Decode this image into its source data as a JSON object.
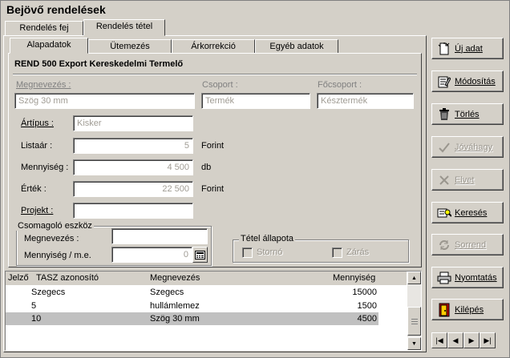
{
  "window": {
    "title": "Bejövő rendelések"
  },
  "outer_tabs": [
    {
      "label": "Rendelés fej"
    },
    {
      "label": "Rendelés tétel"
    }
  ],
  "inner_tabs": [
    {
      "label": "Alapadatok"
    },
    {
      "label": "Ütemezés"
    },
    {
      "label": "Árkorrekció"
    },
    {
      "label": "Egyéb adatok"
    }
  ],
  "header": {
    "text": "REND 500  Export  Kereskedelmi Termelő"
  },
  "form": {
    "megnevezes_label": "Megnevezés :",
    "megnevezes_value": "Szög 30 mm",
    "csoport_label": "Csoport :",
    "csoport_value": "Termék",
    "focsoport_label": "Főcsoport :",
    "focsoport_value": "Késztermék",
    "artipus_label": "Ártípus :",
    "artipus_value": "Kisker",
    "listaar_label": "Listaár :",
    "listaar_value": "5",
    "listaar_unit": "Forint",
    "mennyiseg_label": "Mennyiség :",
    "mennyiseg_value": "4 500",
    "mennyiseg_unit": "db",
    "ertek_label": "Érték :",
    "ertek_value": "22 500",
    "ertek_unit": "Forint",
    "projekt_label": "Projekt :",
    "projekt_value": ""
  },
  "packaging": {
    "title": "Csomagoló eszköz",
    "megnevezes_label": "Megnevezés :",
    "megnevezes_value": "",
    "qty_label": "Mennyiség / m.e.",
    "qty_value": "0"
  },
  "status": {
    "title": "Tétel állapota",
    "storno_label": "Stornó",
    "zaras_label": "Zárás"
  },
  "grid": {
    "columns": [
      "Jelző",
      "TASZ azonosító",
      "Megnevezés",
      "Mennyiség"
    ],
    "rows": [
      {
        "tasz": "Szegecs",
        "megnevezes": "Szegecs",
        "mennyiseg": "15000"
      },
      {
        "tasz": "5",
        "megnevezes": "hullámlemez",
        "mennyiseg": "1500"
      },
      {
        "tasz": "10",
        "megnevezes": "Szög 30 mm",
        "mennyiseg": "4500"
      }
    ]
  },
  "buttons": {
    "uj_adat": "Új adat",
    "modositas": "Módosítás",
    "torles": "Törlés",
    "jovahagy": "Jóváhagy",
    "elvet": "Elvet",
    "kereses": "Keresés",
    "sorrend": "Sorrend",
    "nyomtatas": "Nyomtatás",
    "kilepes": "Kilépés"
  },
  "icons": {
    "uj_adat": "new-document-icon",
    "modositas": "edit-icon",
    "torles": "trash-icon",
    "jovahagy": "checkmark-icon",
    "elvet": "cancel-icon",
    "kereses": "search-icon",
    "sorrend": "sort-icon",
    "nyomtatas": "printer-icon",
    "kilepes": "exit-door-icon"
  },
  "colors": {
    "face": "#d4d0c8",
    "selected_row": "#c0c0c0",
    "readonly_text": "#a09c94"
  }
}
